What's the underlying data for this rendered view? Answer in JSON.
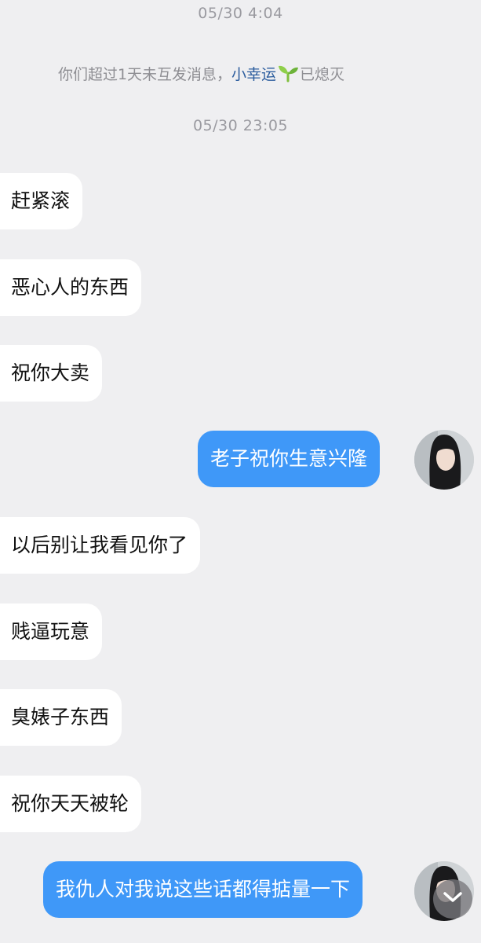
{
  "timestamps": {
    "top": "05/30 4:04",
    "second": "05/30 23:05"
  },
  "system_note": {
    "prefix": "你们超过1天未互发消息，",
    "name": "小幸运",
    "suffix": "已熄灭",
    "icon": "sprout-icon"
  },
  "messages": [
    {
      "side": "in",
      "text": "赶紧滚"
    },
    {
      "side": "in",
      "text": "恶心人的东西"
    },
    {
      "side": "in",
      "text": "祝你大卖"
    },
    {
      "side": "out",
      "text": "老子祝你生意兴隆"
    },
    {
      "side": "in",
      "text": "以后别让我看见你了"
    },
    {
      "side": "in",
      "text": "贱逼玩意"
    },
    {
      "side": "in",
      "text": "臭婊子东西"
    },
    {
      "side": "in",
      "text": "祝你天天被轮"
    },
    {
      "side": "out",
      "text": "我仇人对我说这些话都得掂量一下"
    }
  ],
  "colors": {
    "background": "#efeff1",
    "incoming_bubble": "#ffffff",
    "outgoing_bubble": "#3f98f8",
    "name_link": "#2c5d9e"
  },
  "icons": {
    "scroll_down": "chevron-down-icon",
    "avatar": "avatar"
  }
}
